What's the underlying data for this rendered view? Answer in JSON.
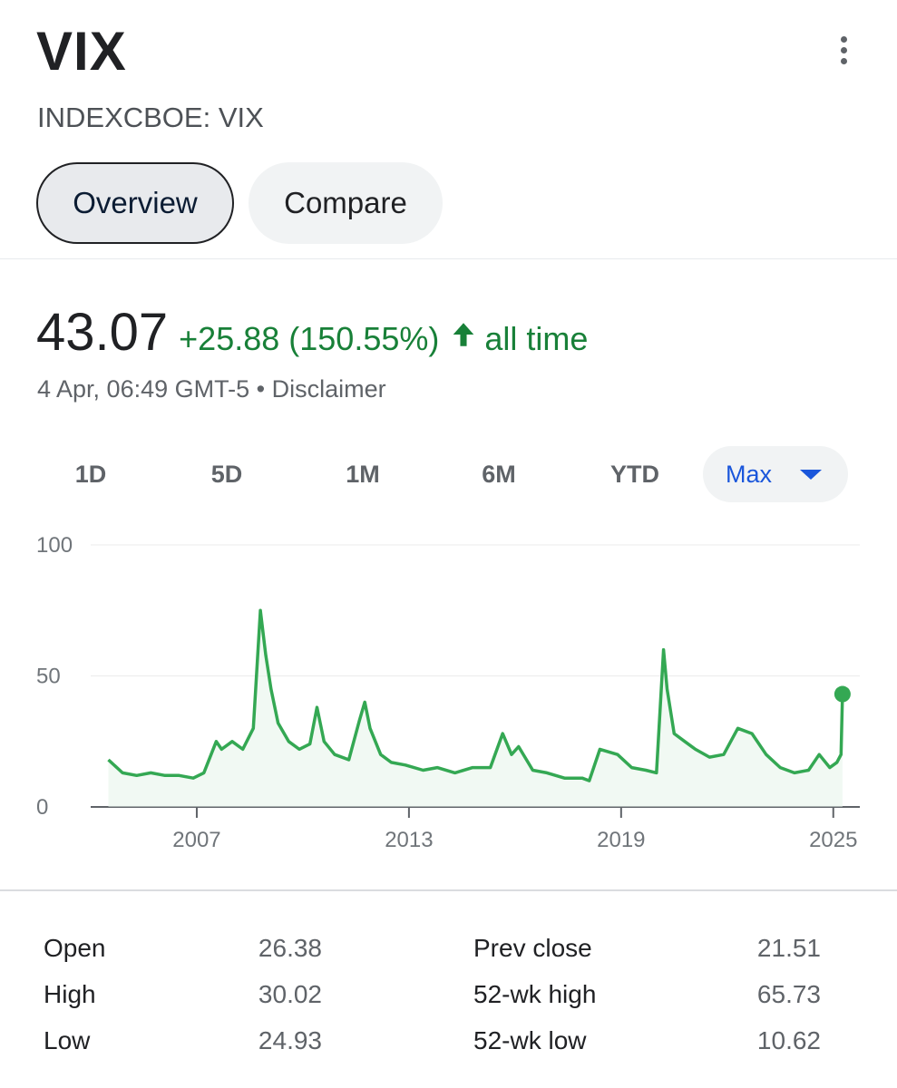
{
  "header": {
    "title": "VIX",
    "subtitle": "INDEXCBOE: VIX",
    "menu_icon": "more-vert-icon"
  },
  "tabs": [
    {
      "label": "Overview",
      "active": true
    },
    {
      "label": "Compare",
      "active": false
    }
  ],
  "quote": {
    "price": "43.07",
    "change": "+25.88 (150.55%)",
    "direction_icon": "arrow-up-icon",
    "period": "all time",
    "timestamp": "4 Apr, 06:49 GMT-5",
    "separator": "•",
    "disclaimer": "Disclaimer",
    "color_positive": "#188038"
  },
  "ranges": {
    "items": [
      "1D",
      "5D",
      "1M",
      "6M",
      "YTD"
    ],
    "selected": "Max",
    "selected_icon": "caret-down-icon",
    "accent": "#1a56db"
  },
  "chart_data": {
    "type": "area",
    "ylim": [
      0,
      100
    ],
    "y_ticks": [
      "100",
      "50",
      "0"
    ],
    "x_ticks": [
      "2007",
      "2013",
      "2019",
      "2025"
    ],
    "line_color": "#34a853",
    "x": [
      2004.5,
      2004.9,
      2005.3,
      2005.7,
      2006.1,
      2006.5,
      2006.9,
      2007.2,
      2007.55,
      2007.7,
      2008.0,
      2008.3,
      2008.6,
      2008.8,
      2008.95,
      2009.1,
      2009.3,
      2009.6,
      2009.9,
      2010.2,
      2010.4,
      2010.6,
      2010.9,
      2011.3,
      2011.6,
      2011.75,
      2011.9,
      2012.2,
      2012.5,
      2012.9,
      2013.4,
      2013.8,
      2014.3,
      2014.8,
      2015.3,
      2015.65,
      2015.9,
      2016.1,
      2016.5,
      2016.9,
      2017.4,
      2017.9,
      2018.1,
      2018.4,
      2018.9,
      2019.3,
      2019.7,
      2020.0,
      2020.2,
      2020.3,
      2020.5,
      2020.8,
      2021.1,
      2021.5,
      2021.9,
      2022.3,
      2022.7,
      2023.1,
      2023.5,
      2023.9,
      2024.3,
      2024.6,
      2024.9,
      2025.1,
      2025.22,
      2025.26
    ],
    "values": [
      18,
      13,
      12,
      13,
      12,
      12,
      11,
      13,
      25,
      22,
      25,
      22,
      30,
      75,
      58,
      45,
      32,
      25,
      22,
      24,
      38,
      25,
      20,
      18,
      33,
      40,
      30,
      20,
      17,
      16,
      14,
      15,
      13,
      15,
      15,
      28,
      20,
      23,
      14,
      13,
      11,
      11,
      10,
      22,
      20,
      15,
      14,
      13,
      60,
      45,
      28,
      25,
      22,
      19,
      20,
      30,
      28,
      20,
      15,
      13,
      14,
      20,
      15,
      17,
      20,
      43.07
    ]
  },
  "stats": {
    "left": [
      {
        "label": "Open",
        "value": "26.38"
      },
      {
        "label": "High",
        "value": "30.02"
      },
      {
        "label": "Low",
        "value": "24.93"
      }
    ],
    "right": [
      {
        "label": "Prev close",
        "value": "21.51"
      },
      {
        "label": "52-wk high",
        "value": "65.73"
      },
      {
        "label": "52-wk low",
        "value": "10.62"
      }
    ]
  }
}
